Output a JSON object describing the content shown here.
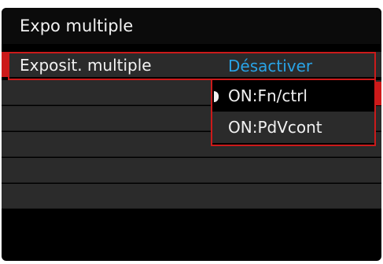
{
  "menu": {
    "title": "Expo multiple",
    "setting_label": "Exposit. multiple",
    "current_value": "Désactiver",
    "options": [
      "ON:Fn/ctrl",
      "ON:PdVcont"
    ],
    "highlighted_option_index": 0
  },
  "colors": {
    "accent_red": "#cc1a1a",
    "value_blue": "#29a3e6",
    "row_gray": "#2b2b2b",
    "background": "#000000"
  }
}
